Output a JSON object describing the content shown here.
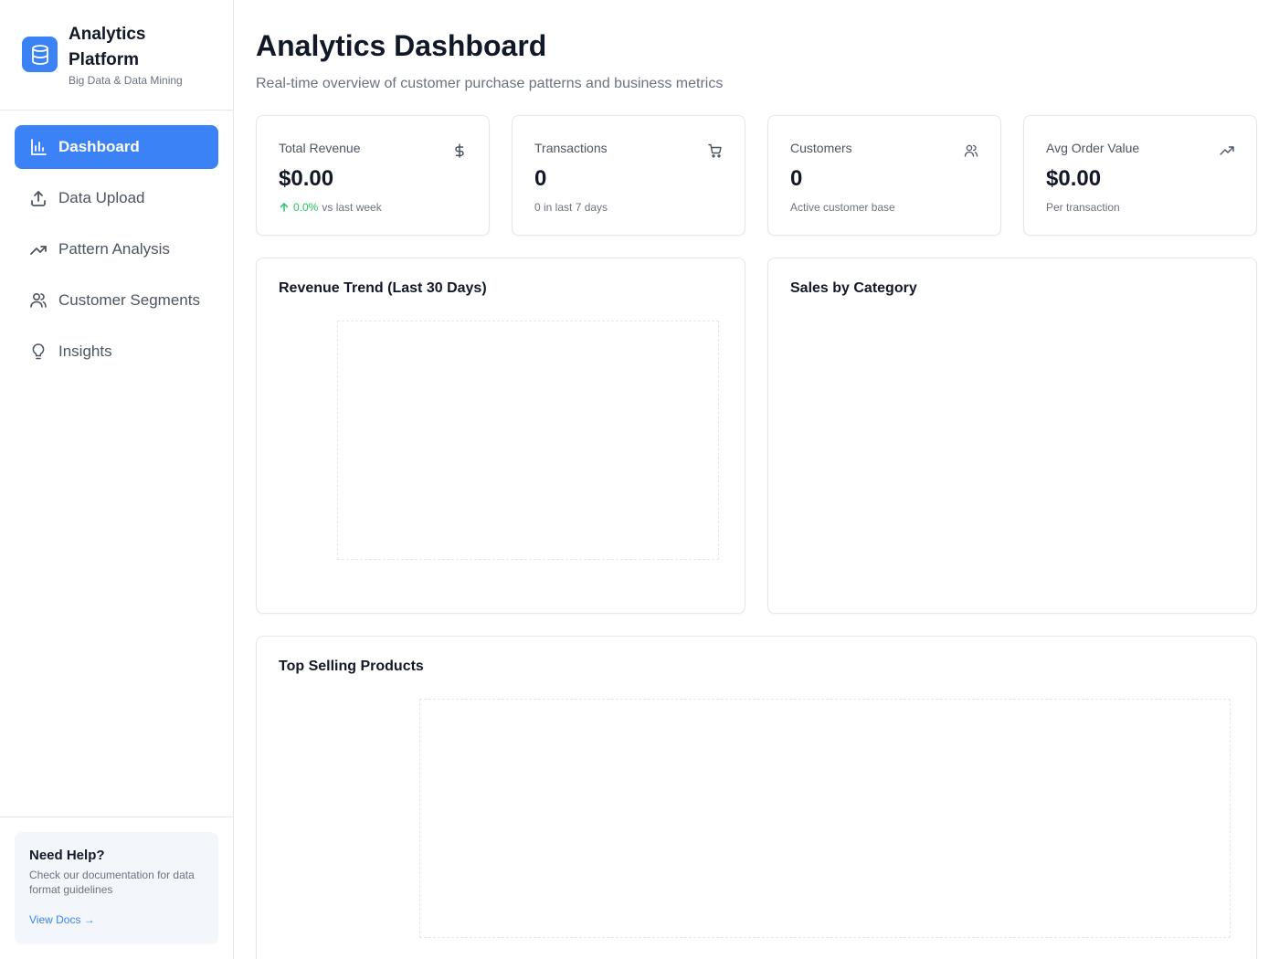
{
  "brand": {
    "title_line1": "Analytics",
    "title_line2": "Platform",
    "subtitle": "Big Data & Data Mining",
    "accent": "#3b82f6",
    "icon": "database-icon"
  },
  "nav": {
    "items": [
      {
        "label": "Dashboard",
        "icon": "bar-chart-icon",
        "active": true
      },
      {
        "label": "Data Upload",
        "icon": "upload-icon",
        "active": false
      },
      {
        "label": "Pattern Analysis",
        "icon": "trending-up-icon",
        "active": false
      },
      {
        "label": "Customer Segments",
        "icon": "users-icon",
        "active": false
      },
      {
        "label": "Insights",
        "icon": "lightbulb-icon",
        "active": false
      }
    ]
  },
  "help": {
    "title": "Need Help?",
    "text": "Check our documentation for data format guidelines",
    "link": "View Docs →"
  },
  "page": {
    "title": "Analytics Dashboard",
    "subtitle": "Real-time overview of customer purchase patterns and business metrics"
  },
  "stats": [
    {
      "label": "Total Revenue",
      "value": "$0.00",
      "note_change": "0.0%",
      "note": "vs last week",
      "icon": "dollar-icon"
    },
    {
      "label": "Transactions",
      "value": "0",
      "note": "0 in last 7 days",
      "icon": "cart-icon"
    },
    {
      "label": "Customers",
      "value": "0",
      "note": "Active customer base",
      "icon": "users-icon"
    },
    {
      "label": "Avg Order Value",
      "value": "$0.00",
      "note": "Per transaction",
      "icon": "trending-up-icon"
    }
  ],
  "cards": {
    "revenue_trend": "Revenue Trend (Last 30 Days)",
    "sales_by_category": "Sales by Category",
    "top_products": "Top Selling Products"
  },
  "colors": {
    "positive": "#22c55e",
    "muted": "#6b7280",
    "border": "#e5e7eb"
  }
}
